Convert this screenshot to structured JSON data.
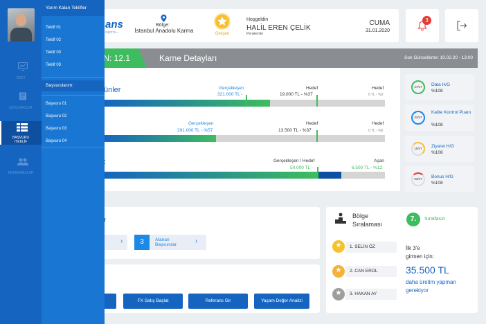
{
  "header": {
    "logo_text": "ans",
    "logo_sub": "sigorta—",
    "region_label": "Bölge:",
    "region_value": "İstanbul Anadolu Karma",
    "badge_label": "Gelişen",
    "welcome_label": "Hoşgeldin",
    "user_name": "HALİL EREN ÇELİK",
    "user_role": "Perakende",
    "day": "CUMA",
    "date": "31.01.2020",
    "notification_count": "3"
  },
  "karne": {
    "left_tag": "IN: 12.1",
    "title": "Karne Detayları",
    "last_update": "Son Güncelleme: 10.02.20 - 13:00",
    "rows": [
      {
        "title": "ünler",
        "actual_label": "Gerçekleşen",
        "actual_value": "321.000 TL -",
        "target_label": "Hedef",
        "target_value": "19.000 TL - %37",
        "goal_label": "Hedef",
        "goal_value": "0 TL - %0",
        "fill_ratio": 0.59
      },
      {
        "title": "",
        "actual_label": "Gerçekleşen",
        "actual_value": "291.000 TL - %57",
        "target_label": "Hedef",
        "target_value": "13.500 TL - %37",
        "goal_label": "Hedef",
        "goal_value": "0 TL - %0",
        "fill_ratio": 0.46
      },
      {
        "title": ":",
        "actual_label": "Gerçekleşen / Hedef",
        "actual_value": "50.000 TL -",
        "over_label": "Aşan",
        "over_value": "6.500 TL - %12",
        "fill_ratio": 0.75,
        "over_ratio": 0.08
      }
    ]
  },
  "kpis": [
    {
      "ring": "47/47",
      "name": "Data H/G",
      "value": "%108",
      "color": "#3dbd5d"
    },
    {
      "ring": "33/47",
      "name": "Kalite Kontrol Puanı",
      "value": "%108",
      "color": "#1e88e5"
    },
    {
      "ring": "15/47",
      "name": "Ziyaret H/G",
      "value": "%108",
      "color": "#f6c12a"
    },
    {
      "ring": "03/47",
      "name": "Bonus H/G",
      "value": "%108",
      "color": "#e53935"
    }
  ],
  "hx": {
    "title": "er",
    "chips": [
      {
        "num": "",
        "label": ""
      },
      {
        "num": "3",
        "label": "Atanan Başvurular"
      }
    ]
  },
  "actions": [
    {
      "label": ""
    },
    {
      "label": "FX Satış Başlat"
    },
    {
      "label": "Referans Gir"
    },
    {
      "label": "Yaşam Değer Analizi"
    }
  ],
  "ranking": {
    "title_line1": "Bölge",
    "title_line2": "Sıralaması",
    "position": "7.",
    "position_label": "Sıradasın",
    "rows": [
      {
        "label": "1. SELİN ÖZ",
        "color": "#f6c12a"
      },
      {
        "label": "2. CAN EROL",
        "color": "#f3b23a"
      },
      {
        "label": "3. HAKAN AY",
        "color": "#9e9e9e"
      }
    ],
    "need_line1": "İlk 3'e",
    "need_line2": "girmen için:",
    "need_amount": "35.500 TL",
    "need_line3": "daha üretim yapman",
    "need_line4": "gerekiyor"
  },
  "sidebar": {
    "items": [
      {
        "label": "ÖZET"
      },
      {
        "label": "SATIŞ BAŞLAT"
      },
      {
        "label": "BAŞVURU /TEKLİF"
      },
      {
        "label": "REFERANSLAR"
      }
    ]
  },
  "flyout": {
    "header": "Yarım Kalan Teklifler",
    "offers": [
      "Teklif 01",
      "Teklif 02",
      "Teklif 03",
      "Teklif 03"
    ],
    "section": "Başvurularım:",
    "applications": [
      "Başvuru 01",
      "Başvuru 02",
      "Başvuru 03",
      "Başvuru 04"
    ]
  },
  "colors": {
    "primary": "#1565c0",
    "accent_green": "#3dbd5d",
    "flyout": "#1976d2",
    "band": "#8a8e92"
  }
}
